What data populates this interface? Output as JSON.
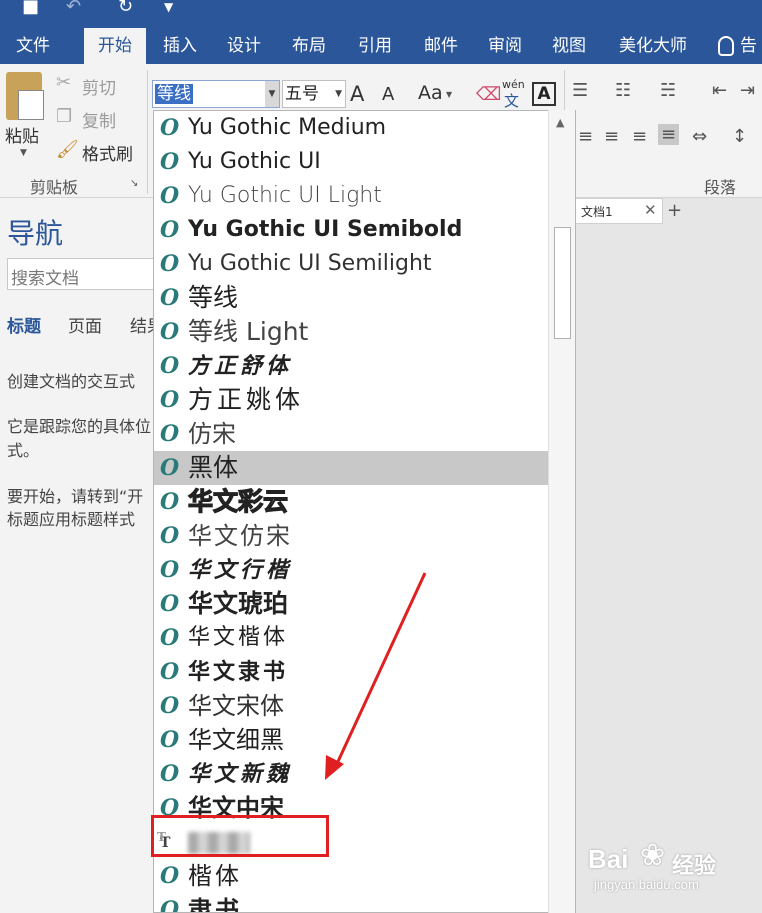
{
  "ribbon_tabs": [
    {
      "label": "文件"
    },
    {
      "label": "开始"
    },
    {
      "label": "插入"
    },
    {
      "label": "设计"
    },
    {
      "label": "布局"
    },
    {
      "label": "引用"
    },
    {
      "label": "邮件"
    },
    {
      "label": "审阅"
    },
    {
      "label": "视图"
    },
    {
      "label": "美化大师"
    },
    {
      "label": "告"
    }
  ],
  "active_tab": "开始",
  "clipboard": {
    "paste": "粘贴",
    "cut": "剪切",
    "copy": "复制",
    "format_painter": "格式刷",
    "group_label": "剪贴板"
  },
  "font": {
    "name_value": "等线",
    "size_value": "五号",
    "grow": "A",
    "shrink": "A",
    "change_case": "Aa",
    "phonetic_top": "wén",
    "phonetic_bottom": "文",
    "border": "A"
  },
  "paragraph": {
    "group_label": "段落"
  },
  "doc_tab": {
    "label": "文档1",
    "close": "✕",
    "add": "+"
  },
  "navigation": {
    "title": "导航",
    "search_placeholder": "搜索文档",
    "tabs": [
      {
        "label": "标题"
      },
      {
        "label": "页面"
      },
      {
        "label": "结果"
      }
    ],
    "lines": [
      "创建文档的交互式",
      "它是跟踪您的具体位",
      "式。",
      "要开始，请转到“开",
      "标题应用标题样式"
    ]
  },
  "font_list": [
    {
      "name": "Yu Gothic Medium",
      "type": "otf"
    },
    {
      "name": "Yu Gothic UI",
      "type": "otf"
    },
    {
      "name": "Yu Gothic UI Light",
      "type": "otf"
    },
    {
      "name": "Yu Gothic UI Semibold",
      "type": "otf"
    },
    {
      "name": "Yu Gothic UI Semilight",
      "type": "otf"
    },
    {
      "name": "等线",
      "type": "otf"
    },
    {
      "name": "等线 Light",
      "type": "otf"
    },
    {
      "name": "方正舒体",
      "type": "otf"
    },
    {
      "name": "方正姚体",
      "type": "otf"
    },
    {
      "name": "仿宋",
      "type": "otf"
    },
    {
      "name": "黑体",
      "type": "otf",
      "selected": true
    },
    {
      "name": "华文彩云",
      "type": "otf"
    },
    {
      "name": "华文仿宋",
      "type": "otf"
    },
    {
      "name": "华文行楷",
      "type": "otf"
    },
    {
      "name": "华文琥珀",
      "type": "otf"
    },
    {
      "name": "华文楷体",
      "type": "otf"
    },
    {
      "name": "华文隶书",
      "type": "otf"
    },
    {
      "name": "华文宋体",
      "type": "otf"
    },
    {
      "name": "华文细黑",
      "type": "otf"
    },
    {
      "name": "华文新魏",
      "type": "otf"
    },
    {
      "name": "华文中宋",
      "type": "otf"
    },
    {
      "name": "",
      "type": "ttf",
      "blurred": true
    },
    {
      "name": "楷体",
      "type": "otf"
    },
    {
      "name": "隶书",
      "type": "otf"
    }
  ],
  "icons": {
    "otf": "O",
    "ttf": "T",
    "ttf_small": "T",
    "scroll_up": "▲",
    "dropdown_arrow": "▼"
  },
  "colors": {
    "ribbon_blue": "#2b579a",
    "selection_gray": "#c8c8c8",
    "annotation_red": "#e02020",
    "otf_icon": "#2b7a7a"
  },
  "watermark": {
    "brand": "Bai",
    "brand2": "经验",
    "url": "jingyan.baidu.com"
  }
}
